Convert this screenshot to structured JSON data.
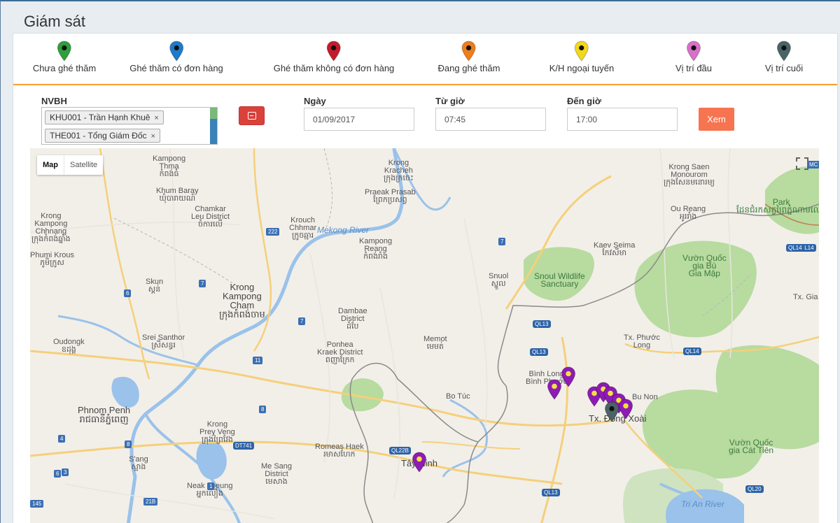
{
  "page": {
    "title": "Giám sát"
  },
  "legend": [
    {
      "label": "Chưa ghé thăm",
      "color": "#2f9e3c",
      "icon": "map-pin-icon"
    },
    {
      "label": "Ghé thăm có đơn hàng",
      "color": "#1f7ac9",
      "icon": "map-pin-icon"
    },
    {
      "label": "Ghé thăm không có đơn hàng",
      "color": "#c51a2d",
      "icon": "map-pin-icon"
    },
    {
      "label": "Đang ghé thăm",
      "color": "#ee7d1a",
      "icon": "map-pin-icon"
    },
    {
      "label": "K/H ngoại tuyến",
      "color": "#f2d81c",
      "icon": "map-pin-icon"
    },
    {
      "label": "Vị trí đầu",
      "color": "#d86fc8",
      "icon": "map-pin-icon"
    },
    {
      "label": "Vị trí cuối",
      "color": "#4a6466",
      "icon": "map-pin-icon"
    }
  ],
  "filters": {
    "nvbh_label": "NVBH",
    "nvbh_tags": [
      "KHU001 - Trần Hạnh Khuê",
      "THE001 - Tổng Giám Đốc"
    ],
    "tag_remove": "×",
    "date_label": "Ngày",
    "date_value": "01/09/2017",
    "from_label": "Từ giờ",
    "from_value": "07:45",
    "to_label": "Đến giờ",
    "to_value": "17:00",
    "view_button": "Xem"
  },
  "map": {
    "type_map": "Map",
    "type_satellite": "Satellite",
    "places": [
      {
        "t": "Kampong\nThma\nកំពង់ធំ",
        "cls": ""
      },
      {
        "t": "Khum Baray\nឃុំបារាយណ៍",
        "cls": ""
      },
      {
        "t": "Chamkar\nLeu District\nចំការលើ",
        "cls": ""
      },
      {
        "t": "Krouch\nChhmar\nក្រូចឆ្មារ",
        "cls": ""
      },
      {
        "t": "Krong\nKracheh\nក្រុងក្រចេះ",
        "cls": ""
      },
      {
        "t": "Praeak Prasab\nព្រែកប្រសព្វ",
        "cls": ""
      },
      {
        "t": "Krong\nKampong\nChhnang\nក្រុងកំពង់ឆ្នាំង",
        "cls": ""
      },
      {
        "t": "Kampong\nReang\nកំពង់រាំង",
        "cls": ""
      },
      {
        "t": "Mekong River",
        "cls": "water"
      },
      {
        "t": "Phumi Krous\nភូមិក្រូស",
        "cls": ""
      },
      {
        "t": "Skun\nស្គន់",
        "cls": ""
      },
      {
        "t": "Krong\nKampong\nCham\nក្រុងកំពង់ចាម",
        "cls": "big"
      },
      {
        "t": "Snuol\nស្នួល",
        "cls": ""
      },
      {
        "t": "Snoul Wildlife\nSanctuary",
        "cls": "green"
      },
      {
        "t": "Kaev Seima\nកែវសីមា",
        "cls": ""
      },
      {
        "t": "Dambae\nDistrict\nដំបែ",
        "cls": ""
      },
      {
        "t": "Srei Santhor\nស្រីសន្ធរ",
        "cls": ""
      },
      {
        "t": "Oudongk\nឧដុង្គ",
        "cls": ""
      },
      {
        "t": "Ponhea\nKraek District\nពញាក្រែក",
        "cls": ""
      },
      {
        "t": "Memot\nមេមត់",
        "cls": ""
      },
      {
        "t": "Phnom Penh\nរាជធានីភ្នំពេញ",
        "cls": "big"
      },
      {
        "t": "Bo Túc",
        "cls": ""
      },
      {
        "t": "Bình Long\nBình Phước",
        "cls": ""
      },
      {
        "t": "Krong\nPrey Veng\nក្រុងព្រៃវែង",
        "cls": ""
      },
      {
        "t": "Romeas Haek\nរមាសហែក",
        "cls": ""
      },
      {
        "t": "Tây Ninh",
        "cls": "big"
      },
      {
        "t": "Tx. Đồng Xoài",
        "cls": "big"
      },
      {
        "t": "Bu Non",
        "cls": ""
      },
      {
        "t": "Tx. Phước\nLong",
        "cls": ""
      },
      {
        "t": "Ou Reang\nអូររាំង",
        "cls": ""
      },
      {
        "t": "Krong Saen\nMonourom\nក្រុងសែនមនោរម្យ",
        "cls": ""
      },
      {
        "t": "Vườn Quốc\ngia Bù\nGia Mập",
        "cls": "green"
      },
      {
        "t": "Park\nដែនជំរកសត្វព្រៃភ្នំណាមលៀវ",
        "cls": "green"
      },
      {
        "t": "Tx. Gia",
        "cls": ""
      },
      {
        "t": "S'ang\nស្អាង",
        "cls": ""
      },
      {
        "t": "Me Sang\nDistrict\nមេសាង",
        "cls": ""
      },
      {
        "t": "Neak Loeung\nអ្នកលឿង",
        "cls": ""
      },
      {
        "t": "Vườn Quốc\ngia Cát Tiên",
        "cls": "green"
      },
      {
        "t": "Tri An River",
        "cls": "water"
      }
    ],
    "shields": [
      "222",
      "7",
      "7",
      "7",
      "6",
      "11",
      "8",
      "8",
      "4",
      "6",
      "1",
      "3",
      "145",
      "21B",
      "QL13",
      "QL13",
      "QL14",
      "QL14",
      "QL22B",
      "QL13",
      "QL20",
      "QL14",
      "DT741",
      "MC"
    ],
    "markers": [
      {
        "color": "#8e1bb5",
        "role": "customer"
      },
      {
        "color": "#8e1bb5",
        "role": "customer"
      },
      {
        "color": "#8e1bb5",
        "role": "customer"
      },
      {
        "color": "#8e1bb5",
        "role": "customer"
      },
      {
        "color": "#8e1bb5",
        "role": "customer"
      },
      {
        "color": "#8e1bb5",
        "role": "customer"
      },
      {
        "color": "#8e1bb5",
        "role": "customer"
      },
      {
        "color": "#8e1bb5",
        "role": "customer"
      },
      {
        "color": "#4a6466",
        "role": "last-position"
      }
    ]
  }
}
